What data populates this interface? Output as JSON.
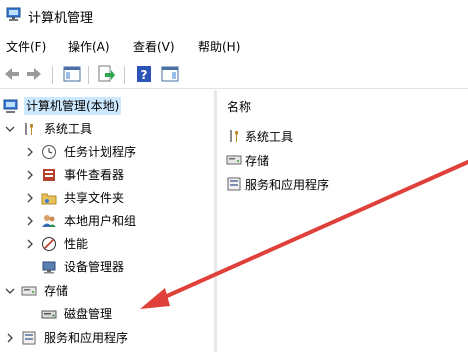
{
  "window": {
    "title": "计算机管理",
    "app_icon": "computer-management-icon"
  },
  "menu": [
    "文件(F)",
    "操作(A)",
    "查看(V)",
    "帮助(H)"
  ],
  "toolbar": {
    "buttons": [
      "back-icon",
      "forward-icon",
      "show-hide-tree-icon",
      "export-list-icon",
      "help-icon",
      "show-hide-action-pane-icon"
    ]
  },
  "tree": {
    "root": "计算机管理(本地)",
    "system_tools": {
      "label": "系统工具",
      "children": [
        "任务计划程序",
        "事件查看器",
        "共享文件夹",
        "本地用户和组",
        "性能",
        "设备管理器"
      ]
    },
    "storage": {
      "label": "存储",
      "children": [
        "磁盘管理"
      ]
    },
    "services": {
      "label": "服务和应用程序"
    }
  },
  "content": {
    "column_header": "名称",
    "items": [
      "系统工具",
      "存储",
      "服务和应用程序"
    ]
  },
  "colors": {
    "selection": "#cce8ff",
    "annotation_arrow": "#e0403a"
  }
}
